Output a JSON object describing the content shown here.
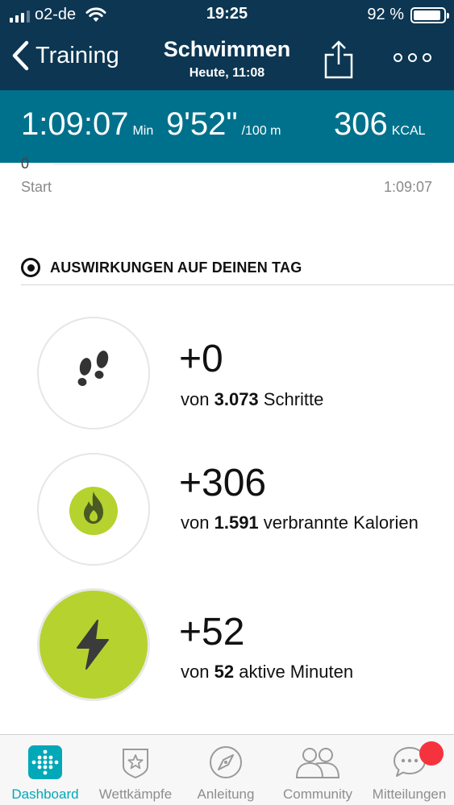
{
  "status_bar": {
    "carrier": "o2-de",
    "time": "19:25",
    "battery_text": "92 %",
    "battery_level": 0.92
  },
  "nav": {
    "back_label": "Training",
    "title": "Schwimmen",
    "subtitle": "Heute, 11:08"
  },
  "stats": {
    "duration": {
      "value": "1:09:07",
      "unit": "Min"
    },
    "pace": {
      "value": "9'52\"",
      "unit": "/100 m"
    },
    "calories": {
      "value": "306",
      "unit": "KCAL"
    }
  },
  "chart_axis": {
    "y_zero": "0",
    "start_label": "Start",
    "end_label": "1:09:07"
  },
  "section": {
    "title": "AUSWIRKUNGEN AUF DEINEN TAG"
  },
  "impacts": [
    {
      "icon": "footprints-icon",
      "delta": "+0",
      "prefix": "von",
      "amount": "3.073",
      "suffix": "Schritte"
    },
    {
      "icon": "flame-icon",
      "delta": "+306",
      "prefix": "von",
      "amount": "1.591",
      "suffix": "verbrannte Kalorien"
    },
    {
      "icon": "lightning-icon",
      "delta": "+52",
      "prefix": "von",
      "amount": "52",
      "suffix": "aktive Minuten"
    }
  ],
  "colors": {
    "nav_bg": "#0c3652",
    "stats_bg": "#00718c",
    "accent_green": "#b6d22f",
    "flame_dark": "#4a5a23",
    "tab_active": "#00a8b8",
    "badge_red": "#f5333f"
  },
  "tabs": [
    {
      "label": "Dashboard",
      "icon": "dashboard-grid-icon",
      "active": true
    },
    {
      "label": "Wettkämpfe",
      "icon": "star-badge-icon",
      "active": false
    },
    {
      "label": "Anleitung",
      "icon": "compass-icon",
      "active": false
    },
    {
      "label": "Community",
      "icon": "people-icon",
      "active": false
    },
    {
      "label": "Mitteilungen",
      "icon": "chat-bubble-icon",
      "active": false,
      "has_badge": true
    }
  ]
}
